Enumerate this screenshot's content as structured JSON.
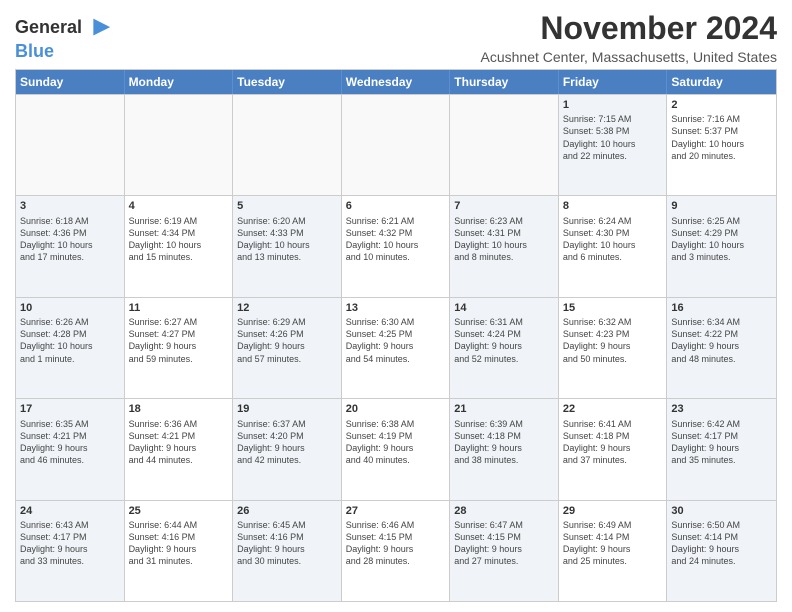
{
  "logo": {
    "line1": "General",
    "line2": "Blue"
  },
  "title": "November 2024",
  "location": "Acushnet Center, Massachusetts, United States",
  "days_of_week": [
    "Sunday",
    "Monday",
    "Tuesday",
    "Wednesday",
    "Thursday",
    "Friday",
    "Saturday"
  ],
  "weeks": [
    [
      {
        "day": "",
        "info": "",
        "empty": true
      },
      {
        "day": "",
        "info": "",
        "empty": true
      },
      {
        "day": "",
        "info": "",
        "empty": true
      },
      {
        "day": "",
        "info": "",
        "empty": true
      },
      {
        "day": "",
        "info": "",
        "empty": true
      },
      {
        "day": "1",
        "info": "Sunrise: 7:15 AM\nSunset: 5:38 PM\nDaylight: 10 hours\nand 22 minutes.",
        "shaded": true
      },
      {
        "day": "2",
        "info": "Sunrise: 7:16 AM\nSunset: 5:37 PM\nDaylight: 10 hours\nand 20 minutes.",
        "shaded": false
      }
    ],
    [
      {
        "day": "3",
        "info": "Sunrise: 6:18 AM\nSunset: 4:36 PM\nDaylight: 10 hours\nand 17 minutes.",
        "shaded": true
      },
      {
        "day": "4",
        "info": "Sunrise: 6:19 AM\nSunset: 4:34 PM\nDaylight: 10 hours\nand 15 minutes.",
        "shaded": false
      },
      {
        "day": "5",
        "info": "Sunrise: 6:20 AM\nSunset: 4:33 PM\nDaylight: 10 hours\nand 13 minutes.",
        "shaded": true
      },
      {
        "day": "6",
        "info": "Sunrise: 6:21 AM\nSunset: 4:32 PM\nDaylight: 10 hours\nand 10 minutes.",
        "shaded": false
      },
      {
        "day": "7",
        "info": "Sunrise: 6:23 AM\nSunset: 4:31 PM\nDaylight: 10 hours\nand 8 minutes.",
        "shaded": true
      },
      {
        "day": "8",
        "info": "Sunrise: 6:24 AM\nSunset: 4:30 PM\nDaylight: 10 hours\nand 6 minutes.",
        "shaded": false
      },
      {
        "day": "9",
        "info": "Sunrise: 6:25 AM\nSunset: 4:29 PM\nDaylight: 10 hours\nand 3 minutes.",
        "shaded": true
      }
    ],
    [
      {
        "day": "10",
        "info": "Sunrise: 6:26 AM\nSunset: 4:28 PM\nDaylight: 10 hours\nand 1 minute.",
        "shaded": true
      },
      {
        "day": "11",
        "info": "Sunrise: 6:27 AM\nSunset: 4:27 PM\nDaylight: 9 hours\nand 59 minutes.",
        "shaded": false
      },
      {
        "day": "12",
        "info": "Sunrise: 6:29 AM\nSunset: 4:26 PM\nDaylight: 9 hours\nand 57 minutes.",
        "shaded": true
      },
      {
        "day": "13",
        "info": "Sunrise: 6:30 AM\nSunset: 4:25 PM\nDaylight: 9 hours\nand 54 minutes.",
        "shaded": false
      },
      {
        "day": "14",
        "info": "Sunrise: 6:31 AM\nSunset: 4:24 PM\nDaylight: 9 hours\nand 52 minutes.",
        "shaded": true
      },
      {
        "day": "15",
        "info": "Sunrise: 6:32 AM\nSunset: 4:23 PM\nDaylight: 9 hours\nand 50 minutes.",
        "shaded": false
      },
      {
        "day": "16",
        "info": "Sunrise: 6:34 AM\nSunset: 4:22 PM\nDaylight: 9 hours\nand 48 minutes.",
        "shaded": true
      }
    ],
    [
      {
        "day": "17",
        "info": "Sunrise: 6:35 AM\nSunset: 4:21 PM\nDaylight: 9 hours\nand 46 minutes.",
        "shaded": true
      },
      {
        "day": "18",
        "info": "Sunrise: 6:36 AM\nSunset: 4:21 PM\nDaylight: 9 hours\nand 44 minutes.",
        "shaded": false
      },
      {
        "day": "19",
        "info": "Sunrise: 6:37 AM\nSunset: 4:20 PM\nDaylight: 9 hours\nand 42 minutes.",
        "shaded": true
      },
      {
        "day": "20",
        "info": "Sunrise: 6:38 AM\nSunset: 4:19 PM\nDaylight: 9 hours\nand 40 minutes.",
        "shaded": false
      },
      {
        "day": "21",
        "info": "Sunrise: 6:39 AM\nSunset: 4:18 PM\nDaylight: 9 hours\nand 38 minutes.",
        "shaded": true
      },
      {
        "day": "22",
        "info": "Sunrise: 6:41 AM\nSunset: 4:18 PM\nDaylight: 9 hours\nand 37 minutes.",
        "shaded": false
      },
      {
        "day": "23",
        "info": "Sunrise: 6:42 AM\nSunset: 4:17 PM\nDaylight: 9 hours\nand 35 minutes.",
        "shaded": true
      }
    ],
    [
      {
        "day": "24",
        "info": "Sunrise: 6:43 AM\nSunset: 4:17 PM\nDaylight: 9 hours\nand 33 minutes.",
        "shaded": true
      },
      {
        "day": "25",
        "info": "Sunrise: 6:44 AM\nSunset: 4:16 PM\nDaylight: 9 hours\nand 31 minutes.",
        "shaded": false
      },
      {
        "day": "26",
        "info": "Sunrise: 6:45 AM\nSunset: 4:16 PM\nDaylight: 9 hours\nand 30 minutes.",
        "shaded": true
      },
      {
        "day": "27",
        "info": "Sunrise: 6:46 AM\nSunset: 4:15 PM\nDaylight: 9 hours\nand 28 minutes.",
        "shaded": false
      },
      {
        "day": "28",
        "info": "Sunrise: 6:47 AM\nSunset: 4:15 PM\nDaylight: 9 hours\nand 27 minutes.",
        "shaded": true
      },
      {
        "day": "29",
        "info": "Sunrise: 6:49 AM\nSunset: 4:14 PM\nDaylight: 9 hours\nand 25 minutes.",
        "shaded": false
      },
      {
        "day": "30",
        "info": "Sunrise: 6:50 AM\nSunset: 4:14 PM\nDaylight: 9 hours\nand 24 minutes.",
        "shaded": true
      }
    ]
  ]
}
